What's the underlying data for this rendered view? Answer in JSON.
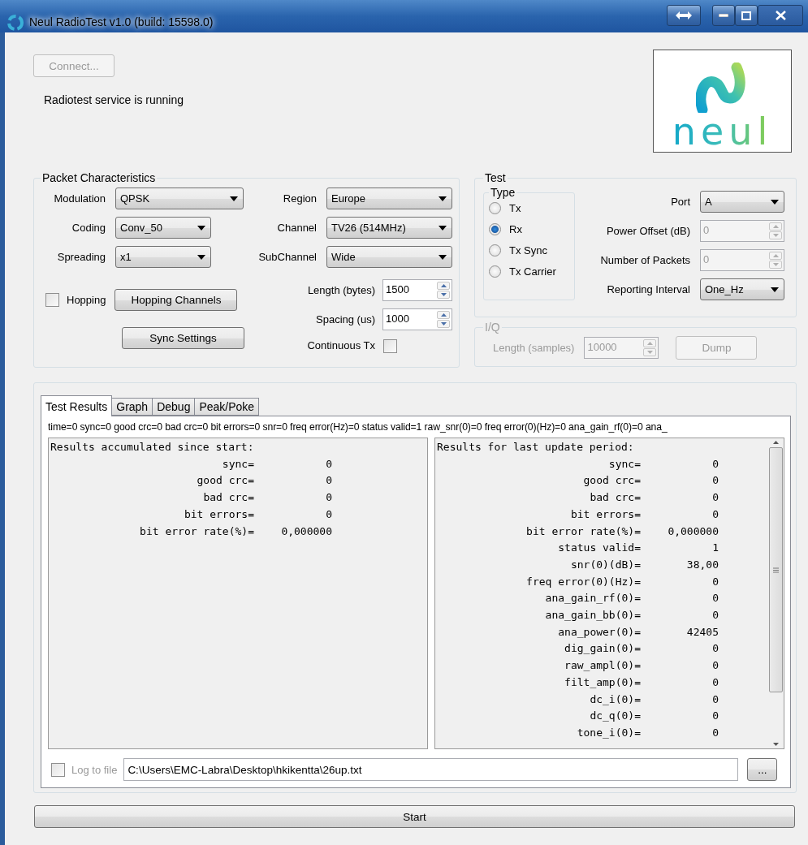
{
  "window": {
    "title": "Neul RadioTest v1.0 (build: 15598.0)"
  },
  "connect_button": {
    "label": "Connect...",
    "disabled": true
  },
  "status_text": "Radiotest service is running",
  "logo": {
    "text": "neul"
  },
  "packet": {
    "title": "Packet Characteristics",
    "dropdowns": [
      {
        "label": "Modulation",
        "value": "QPSK"
      },
      {
        "label": "Region",
        "value": "Europe"
      },
      {
        "label": "Coding",
        "value": "Conv_50"
      },
      {
        "label": "Channel",
        "value": "TV26 (514MHz)"
      },
      {
        "label": "Spreading",
        "value": "x1"
      },
      {
        "label": "SubChannel",
        "value": "Wide"
      }
    ],
    "hopping": {
      "label": "Hopping",
      "checked": false
    },
    "buttons": [
      "Hopping Channels",
      "Sync Settings"
    ],
    "spins": [
      {
        "label": "Length (bytes)",
        "value": "1500"
      },
      {
        "label": "Spacing (us)",
        "value": "1000"
      }
    ],
    "continuous_tx": {
      "label": "Continuous Tx",
      "checked": false
    }
  },
  "test": {
    "title": "Test",
    "type": {
      "title": "Type",
      "options": [
        {
          "label": "Tx",
          "selected": false
        },
        {
          "label": "Rx",
          "selected": true
        },
        {
          "label": "Tx Sync",
          "selected": false
        },
        {
          "label": "Tx Carrier",
          "selected": false
        }
      ]
    },
    "fields": [
      {
        "kind": "dropdown",
        "label": "Port",
        "value": "A",
        "disabled": false
      },
      {
        "kind": "spin",
        "label": "Power Offset (dB)",
        "value": "0",
        "disabled": true
      },
      {
        "kind": "spin",
        "label": "Number of Packets",
        "value": "0",
        "disabled": true
      },
      {
        "kind": "dropdown",
        "label": "Reporting Interval",
        "value": "One_Hz",
        "disabled": false
      }
    ]
  },
  "iq": {
    "title": "I/Q",
    "disabled": true,
    "length_label": "Length (samples)",
    "length_value": "10000",
    "dump_button": "Dump"
  },
  "tabs": [
    {
      "label": "Test Results",
      "selected": true
    },
    {
      "label": "Graph",
      "selected": false
    },
    {
      "label": "Debug",
      "selected": false
    },
    {
      "label": "Peak/Poke",
      "selected": false
    }
  ],
  "summary_line": "time=0 sync=0 good crc=0 bad crc=0 bit errors=0 snr=0 freq error(Hz)=0 status valid=1 raw_snr(0)=0 freq error(0)(Hz)=0 ana_gain_rf(0)=0 ana_",
  "results": [
    {
      "title": "Results accumulated since start:",
      "scrollbar": false,
      "rows": [
        {
          "label": "sync=",
          "value": "0"
        },
        {
          "label": "good crc=",
          "value": "0"
        },
        {
          "label": "bad crc=",
          "value": "0"
        },
        {
          "label": "bit errors=",
          "value": "0"
        },
        {
          "label": "bit error rate(%)=",
          "value": "0,000000"
        }
      ]
    },
    {
      "title": "Results for last update period:",
      "scrollbar": true,
      "rows": [
        {
          "label": "sync=",
          "value": "0"
        },
        {
          "label": "good crc=",
          "value": "0"
        },
        {
          "label": "bad crc=",
          "value": "0"
        },
        {
          "label": "bit errors=",
          "value": "0"
        },
        {
          "label": "bit error rate(%)=",
          "value": "0,000000"
        },
        {
          "label": "status valid=",
          "value": "1"
        },
        {
          "label": "snr(0)(dB)=",
          "value": "38,00"
        },
        {
          "label": "freq error(0)(Hz)=",
          "value": "0"
        },
        {
          "label": "ana_gain_rf(0)=",
          "value": "0"
        },
        {
          "label": "ana_gain_bb(0)=",
          "value": "0"
        },
        {
          "label": "ana_power(0)=",
          "value": "42405"
        },
        {
          "label": "dig_gain(0)=",
          "value": "0"
        },
        {
          "label": "raw_ampl(0)=",
          "value": "0"
        },
        {
          "label": "filt_amp(0)=",
          "value": "0"
        },
        {
          "label": "dc_i(0)=",
          "value": "0"
        },
        {
          "label": "dc_q(0)=",
          "value": "0"
        },
        {
          "label": "tone_i(0)=",
          "value": "0"
        }
      ]
    }
  ],
  "log": {
    "label": "Log to file",
    "checked": false,
    "path": "C:\\Users\\EMC-Labra\\Desktop\\hkikentta\\26up.txt",
    "browse_button": "..."
  },
  "start_button": "Start"
}
